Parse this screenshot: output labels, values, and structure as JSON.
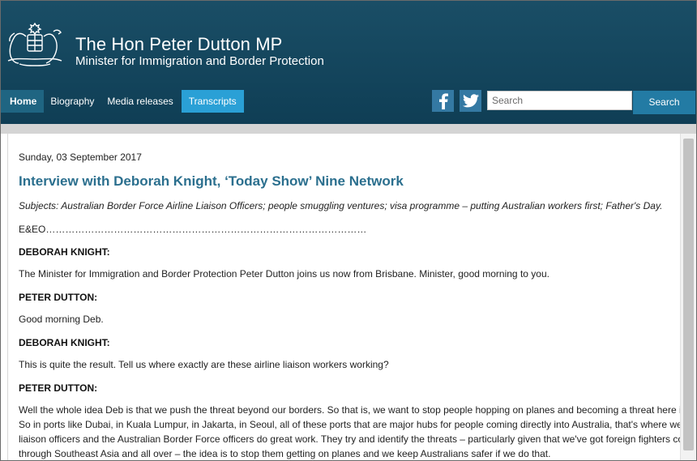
{
  "site": {
    "title": "The Hon Peter Dutton MP",
    "subtitle": "Minister for Immigration and Border Protection"
  },
  "nav": {
    "items": [
      {
        "label": "Home"
      },
      {
        "label": "Biography"
      },
      {
        "label": "Media releases"
      },
      {
        "label": "Transcripts"
      }
    ]
  },
  "search": {
    "placeholder": "Search",
    "button_label": "Search"
  },
  "icons": {
    "crest": "commonwealth-crest-icon",
    "facebook": "facebook-icon",
    "twitter": "twitter-icon"
  },
  "colors": {
    "header": "#0f3e55",
    "active_tab": "#2aa0d6",
    "headline": "#2b6f8e",
    "search_button": "#237ba4"
  },
  "article": {
    "date": "Sunday, 03 September 2017",
    "headline": "Interview with Deborah Knight, ‘Today Show’ Nine Network",
    "subjects": "Subjects: Australian Border Force Airline Liaison Officers; people smuggling ventures; visa programme – putting Australian workers first; Father's Day.",
    "eeo": "E&EO………………………………………………………………………………………",
    "blocks": [
      {
        "speaker": "DEBORAH KNIGHT:",
        "text": "The Minister for Immigration and Border Protection Peter Dutton joins us now from Brisbane. Minister, good morning to you."
      },
      {
        "speaker": "PETER DUTTON:",
        "text": "Good morning Deb."
      },
      {
        "speaker": "DEBORAH KNIGHT:",
        "text": "This is quite the result. Tell us where exactly are these airline liaison workers working?"
      },
      {
        "speaker": "PETER DUTTON:",
        "text_lines": [
          "Well the whole idea Deb is that we push the threat beyond our borders. So that is, we want to stop people hopping on planes and becoming a threat here in Australia.",
          "So in ports like Dubai, in Kuala Lumpur, in Jakarta, in Seoul, all of these ports that are major hubs for people coming directly into Australia, that's where we've got our",
          "liaison officers and the Australian Border Force officers do great work. They try and identify the threats – particularly given that we've got foreign fighters coming back",
          "through Southeast Asia and all over – the idea is to stop them getting on planes and we keep Australians safer if we do that."
        ]
      }
    ]
  }
}
